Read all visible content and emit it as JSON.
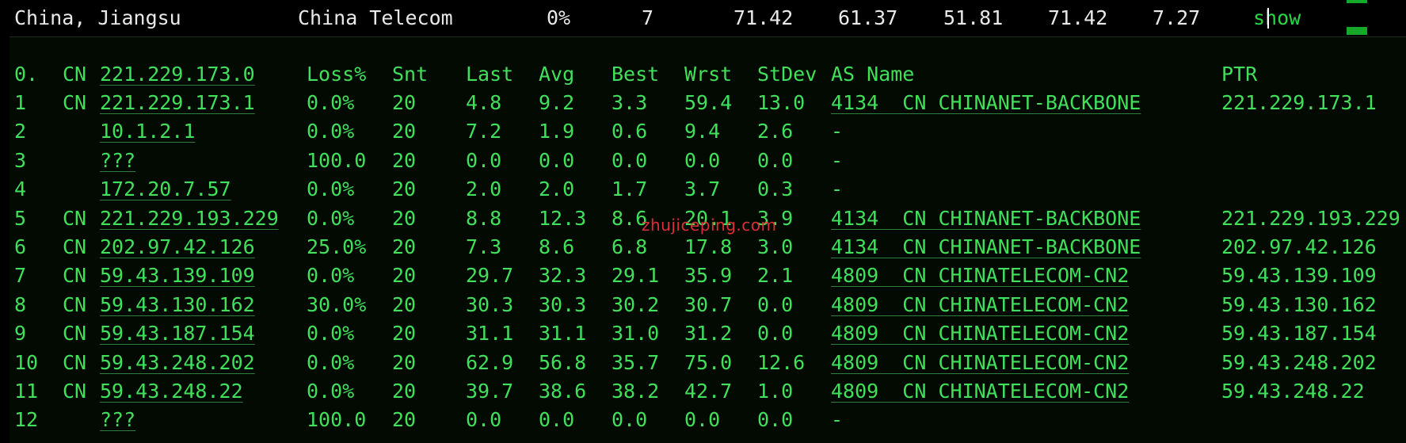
{
  "summary": {
    "location": "China, Jiangsu",
    "isp": "China Telecom",
    "loss": "0%",
    "sent": "7",
    "last": "71.42",
    "avg": "61.37",
    "best": "51.81",
    "worst": "71.42",
    "stdev": "7.27",
    "show_label": "show"
  },
  "colors": {
    "terminal_green": "#41e05a",
    "link_green": "#27d643",
    "watermark_red": "#f0303a",
    "background": "#000000"
  },
  "header": {
    "hop": "0.",
    "cc": "CN",
    "host": "221.229.173.0",
    "loss": "Loss%",
    "snt": "Snt",
    "last": "Last",
    "avg": "Avg",
    "best": "Best",
    "wrst": "Wrst",
    "stdev": "StDev",
    "as_name": "AS Name",
    "ptr": "PTR"
  },
  "hops": [
    {
      "hop": "1",
      "cc": "CN",
      "host": "221.229.173.1",
      "loss": "0.0%",
      "snt": "20",
      "last": "4.8",
      "avg": "9.2",
      "best": "3.3",
      "wrst": "59.4",
      "stdev": "13.0",
      "asn": "4134",
      "as_cc": "CN",
      "as_name": "CHINANET-BACKBONE",
      "ptr": "221.229.173.1"
    },
    {
      "hop": "2",
      "cc": "",
      "host": "10.1.2.1",
      "loss": "0.0%",
      "snt": "20",
      "last": "7.2",
      "avg": "1.9",
      "best": "0.6",
      "wrst": "9.4",
      "stdev": "2.6",
      "asn": "-",
      "as_cc": "",
      "as_name": "",
      "ptr": ""
    },
    {
      "hop": "3",
      "cc": "",
      "host": "???",
      "loss": "100.0",
      "snt": "20",
      "last": "0.0",
      "avg": "0.0",
      "best": "0.0",
      "wrst": "0.0",
      "stdev": "0.0",
      "asn": "-",
      "as_cc": "",
      "as_name": "",
      "ptr": ""
    },
    {
      "hop": "4",
      "cc": "",
      "host": "172.20.7.57",
      "loss": "0.0%",
      "snt": "20",
      "last": "2.0",
      "avg": "2.0",
      "best": "1.7",
      "wrst": "3.7",
      "stdev": "0.3",
      "asn": "-",
      "as_cc": "",
      "as_name": "",
      "ptr": ""
    },
    {
      "hop": "5",
      "cc": "CN",
      "host": "221.229.193.229",
      "loss": "0.0%",
      "snt": "20",
      "last": "8.8",
      "avg": "12.3",
      "best": "8.6",
      "wrst": "20.1",
      "stdev": "3.9",
      "asn": "4134",
      "as_cc": "CN",
      "as_name": "CHINANET-BACKBONE",
      "ptr": "221.229.193.229"
    },
    {
      "hop": "6",
      "cc": "CN",
      "host": "202.97.42.126",
      "loss": "25.0%",
      "snt": "20",
      "last": "7.3",
      "avg": "8.6",
      "best": "6.8",
      "wrst": "17.8",
      "stdev": "3.0",
      "asn": "4134",
      "as_cc": "CN",
      "as_name": "CHINANET-BACKBONE",
      "ptr": "202.97.42.126"
    },
    {
      "hop": "7",
      "cc": "CN",
      "host": "59.43.139.109",
      "loss": "0.0%",
      "snt": "20",
      "last": "29.7",
      "avg": "32.3",
      "best": "29.1",
      "wrst": "35.9",
      "stdev": "2.1",
      "asn": "4809",
      "as_cc": "CN",
      "as_name": "CHINATELECOM-CN2",
      "ptr": "59.43.139.109"
    },
    {
      "hop": "8",
      "cc": "CN",
      "host": "59.43.130.162",
      "loss": "30.0%",
      "snt": "20",
      "last": "30.3",
      "avg": "30.3",
      "best": "30.2",
      "wrst": "30.7",
      "stdev": "0.0",
      "asn": "4809",
      "as_cc": "CN",
      "as_name": "CHINATELECOM-CN2",
      "ptr": "59.43.130.162"
    },
    {
      "hop": "9",
      "cc": "CN",
      "host": "59.43.187.154",
      "loss": "0.0%",
      "snt": "20",
      "last": "31.1",
      "avg": "31.1",
      "best": "31.0",
      "wrst": "31.2",
      "stdev": "0.0",
      "asn": "4809",
      "as_cc": "CN",
      "as_name": "CHINATELECOM-CN2",
      "ptr": "59.43.187.154"
    },
    {
      "hop": "10",
      "cc": "CN",
      "host": "59.43.248.202",
      "loss": "0.0%",
      "snt": "20",
      "last": "62.9",
      "avg": "56.8",
      "best": "35.7",
      "wrst": "75.0",
      "stdev": "12.6",
      "asn": "4809",
      "as_cc": "CN",
      "as_name": "CHINATELECOM-CN2",
      "ptr": "59.43.248.202"
    },
    {
      "hop": "11",
      "cc": "CN",
      "host": "59.43.248.22",
      "loss": "0.0%",
      "snt": "20",
      "last": "39.7",
      "avg": "38.6",
      "best": "38.2",
      "wrst": "42.7",
      "stdev": "1.0",
      "asn": "4809",
      "as_cc": "CN",
      "as_name": "CHINATELECOM-CN2",
      "ptr": "59.43.248.22"
    },
    {
      "hop": "12",
      "cc": "",
      "host": "???",
      "loss": "100.0",
      "snt": "20",
      "last": "0.0",
      "avg": "0.0",
      "best": "0.0",
      "wrst": "0.0",
      "stdev": "0.0",
      "asn": "-",
      "as_cc": "",
      "as_name": "",
      "ptr": ""
    }
  ],
  "watermark": "zhujiceping.com"
}
